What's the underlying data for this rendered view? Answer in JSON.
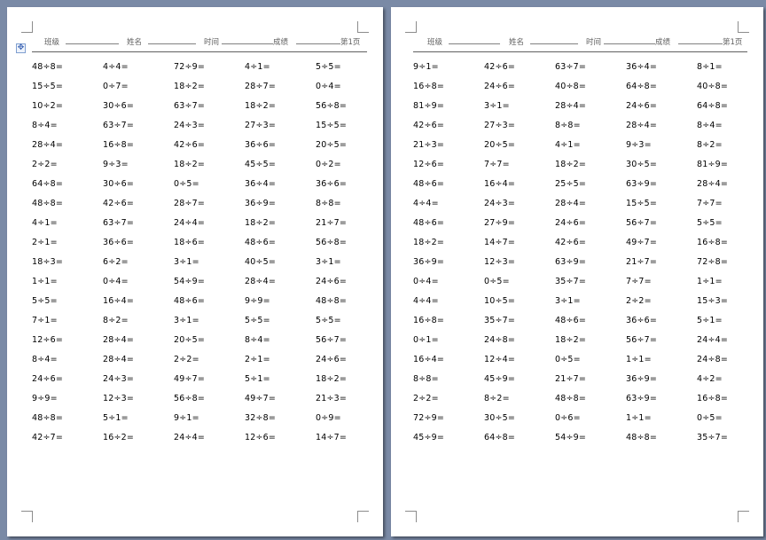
{
  "header": {
    "class_label": "班级",
    "name_label": "姓名",
    "time_label": "时间",
    "score_label": "成绩",
    "page_label": "第1页"
  },
  "pages": [
    {
      "rows": [
        [
          "48÷8=",
          "4÷4=",
          "72÷9=",
          "4÷1=",
          "5÷5="
        ],
        [
          "15÷5=",
          "0÷7=",
          "18÷2=",
          "28÷7=",
          "0÷4="
        ],
        [
          "10÷2=",
          "30÷6=",
          "63÷7=",
          "18÷2=",
          "56÷8="
        ],
        [
          "8÷4=",
          "63÷7=",
          "24÷3=",
          "27÷3=",
          "15÷5="
        ],
        [
          "28÷4=",
          "16÷8=",
          "42÷6=",
          "36÷6=",
          "20÷5="
        ],
        [
          "2÷2=",
          "9÷3=",
          "18÷2=",
          "45÷5=",
          "0÷2="
        ],
        [
          "64÷8=",
          "30÷6=",
          "0÷5=",
          "36÷4=",
          "36÷6="
        ],
        [
          "48÷8=",
          "42÷6=",
          "28÷7=",
          "36÷9=",
          "8÷8="
        ],
        [
          "4÷1=",
          "63÷7=",
          "24÷4=",
          "18÷2=",
          "21÷7="
        ],
        [
          "2÷1=",
          "36÷6=",
          "18÷6=",
          "48÷6=",
          "56÷8="
        ],
        [
          "18÷3=",
          "6÷2=",
          "3÷1=",
          "40÷5=",
          "3÷1="
        ],
        [
          "1÷1=",
          "0÷4=",
          "54÷9=",
          "28÷4=",
          "24÷6="
        ],
        [
          "5÷5=",
          "16÷4=",
          "48÷6=",
          "9÷9=",
          "48÷8="
        ],
        [
          "7÷1=",
          "8÷2=",
          "3÷1=",
          "5÷5=",
          "5÷5="
        ],
        [
          "12÷6=",
          "28÷4=",
          "20÷5=",
          "8÷4=",
          "56÷7="
        ],
        [
          "8÷4=",
          "28÷4=",
          "2÷2=",
          "2÷1=",
          "24÷6="
        ],
        [
          "24÷6=",
          "24÷3=",
          "49÷7=",
          "5÷1=",
          "18÷2="
        ],
        [
          "9÷9=",
          "12÷3=",
          "56÷8=",
          "49÷7=",
          "21÷3="
        ],
        [
          "48÷8=",
          "5÷1=",
          "9÷1=",
          "32÷8=",
          "0÷9="
        ],
        [
          "42÷7=",
          "16÷2=",
          "24÷4=",
          "12÷6=",
          "14÷7="
        ]
      ]
    },
    {
      "rows": [
        [
          "9÷1=",
          "42÷6=",
          "63÷7=",
          "36÷4=",
          "8÷1="
        ],
        [
          "16÷8=",
          "24÷6=",
          "40÷8=",
          "64÷8=",
          "40÷8="
        ],
        [
          "81÷9=",
          "3÷1=",
          "28÷4=",
          "24÷6=",
          "64÷8="
        ],
        [
          "42÷6=",
          "27÷3=",
          "8÷8=",
          "28÷4=",
          "8÷4="
        ],
        [
          "21÷3=",
          "20÷5=",
          "4÷1=",
          "9÷3=",
          "8÷2="
        ],
        [
          "12÷6=",
          "7÷7=",
          "18÷2=",
          "30÷5=",
          "81÷9="
        ],
        [
          "48÷6=",
          "16÷4=",
          "25÷5=",
          "63÷9=",
          "28÷4="
        ],
        [
          "4÷4=",
          "24÷3=",
          "28÷4=",
          "15÷5=",
          "7÷7="
        ],
        [
          "48÷6=",
          "27÷9=",
          "24÷6=",
          "56÷7=",
          "5÷5="
        ],
        [
          "18÷2=",
          "14÷7=",
          "42÷6=",
          "49÷7=",
          "16÷8="
        ],
        [
          "36÷9=",
          "12÷3=",
          "63÷9=",
          "21÷7=",
          "72÷8="
        ],
        [
          "0÷4=",
          "0÷5=",
          "35÷7=",
          "7÷7=",
          "1÷1="
        ],
        [
          "4÷4=",
          "10÷5=",
          "3÷1=",
          "2÷2=",
          "15÷3="
        ],
        [
          "16÷8=",
          "35÷7=",
          "48÷6=",
          "36÷6=",
          "5÷1="
        ],
        [
          "0÷1=",
          "24÷8=",
          "18÷2=",
          "56÷7=",
          "24÷4="
        ],
        [
          "16÷4=",
          "12÷4=",
          "0÷5=",
          "1÷1=",
          "24÷8="
        ],
        [
          "8÷8=",
          "45÷9=",
          "21÷7=",
          "36÷9=",
          "4÷2="
        ],
        [
          "2÷2=",
          "8÷2=",
          "48÷8=",
          "63÷9=",
          "16÷8="
        ],
        [
          "72÷9=",
          "30÷5=",
          "0÷6=",
          "1÷1=",
          "0÷5="
        ],
        [
          "45÷9=",
          "64÷8=",
          "54÷9=",
          "48÷8=",
          "35÷7="
        ]
      ]
    }
  ]
}
